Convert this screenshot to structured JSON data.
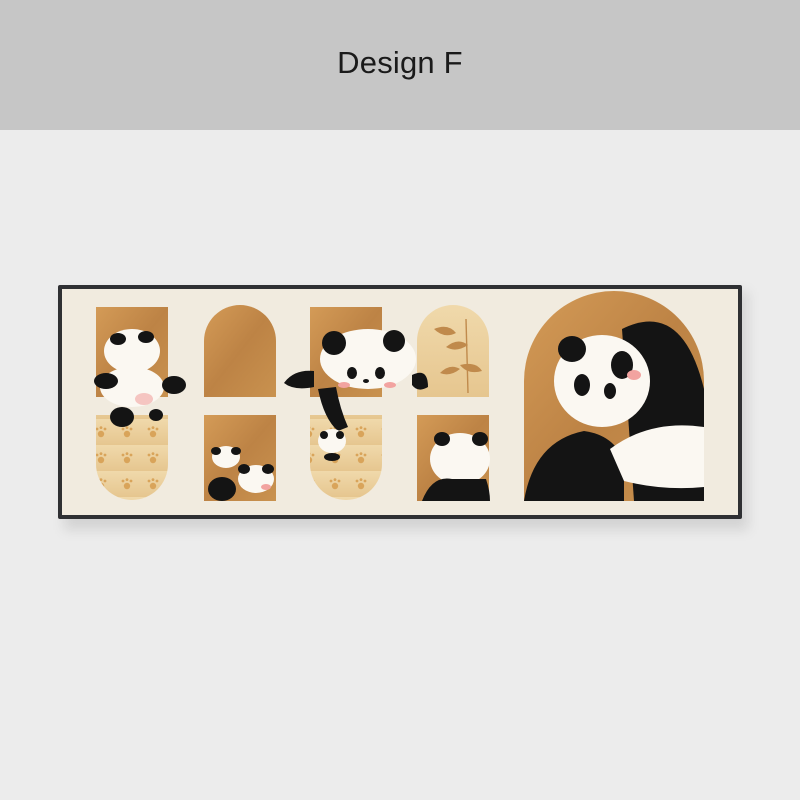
{
  "header": {
    "title": "Design F"
  },
  "artwork": {
    "subject": "panda-wall-art",
    "colors": {
      "frame": "#2f3033",
      "mat": "#f1ebdf",
      "wood": "#c98f4f",
      "wood_light": "#e9cf9e",
      "panda_black": "#141414",
      "panda_white": "#fbf8f2",
      "blush": "#f2a3a0"
    }
  }
}
